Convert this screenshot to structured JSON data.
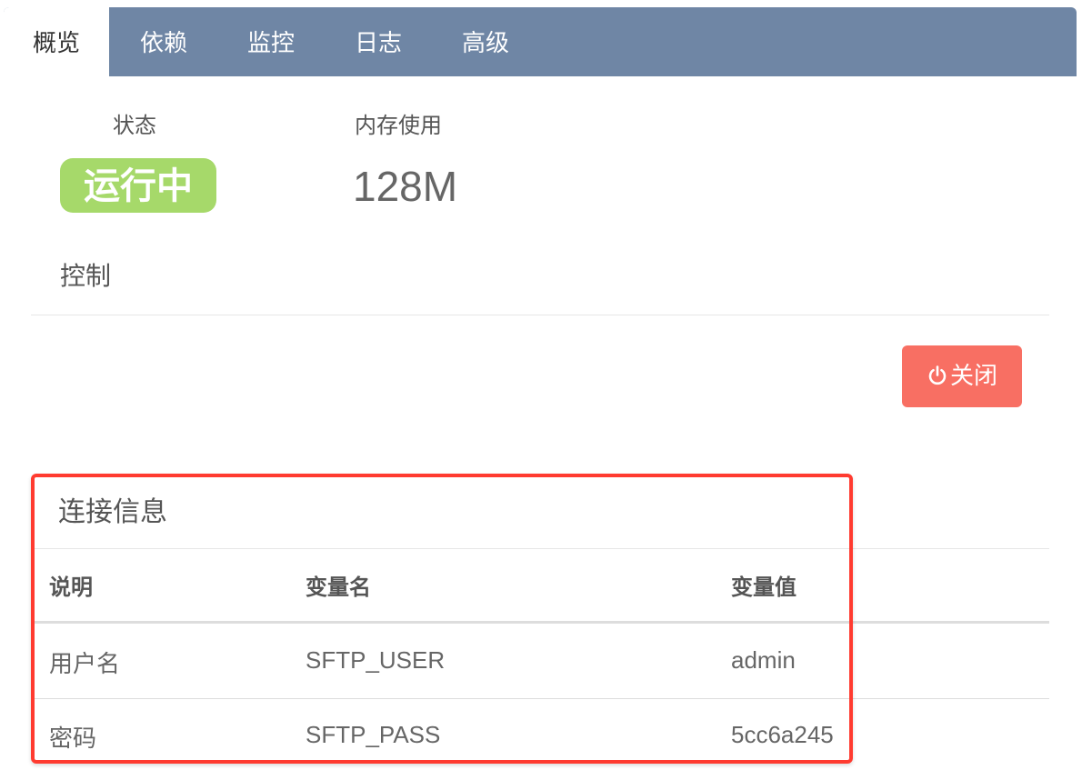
{
  "tabs": [
    "概览",
    "依赖",
    "监控",
    "日志",
    "高级"
  ],
  "active_tab": "概览",
  "status": {
    "label": "状态",
    "value": "运行中",
    "badge_color": "#a6d96a"
  },
  "memory": {
    "label": "内存使用",
    "value": "128M"
  },
  "control": {
    "title": "控制",
    "close_button": "关闭",
    "close_icon": "power-icon",
    "button_color": "#f86f63"
  },
  "connection": {
    "title": "连接信息",
    "headers": [
      "说明",
      "变量名",
      "变量值"
    ],
    "rows": [
      [
        "用户名",
        "SFTP_USER",
        "admin"
      ],
      [
        "密码",
        "SFTP_PASS",
        "5cc6a245"
      ]
    ],
    "highlight_color": "#ff3b30"
  },
  "colors": {
    "tabbar": "#6f86a5"
  }
}
